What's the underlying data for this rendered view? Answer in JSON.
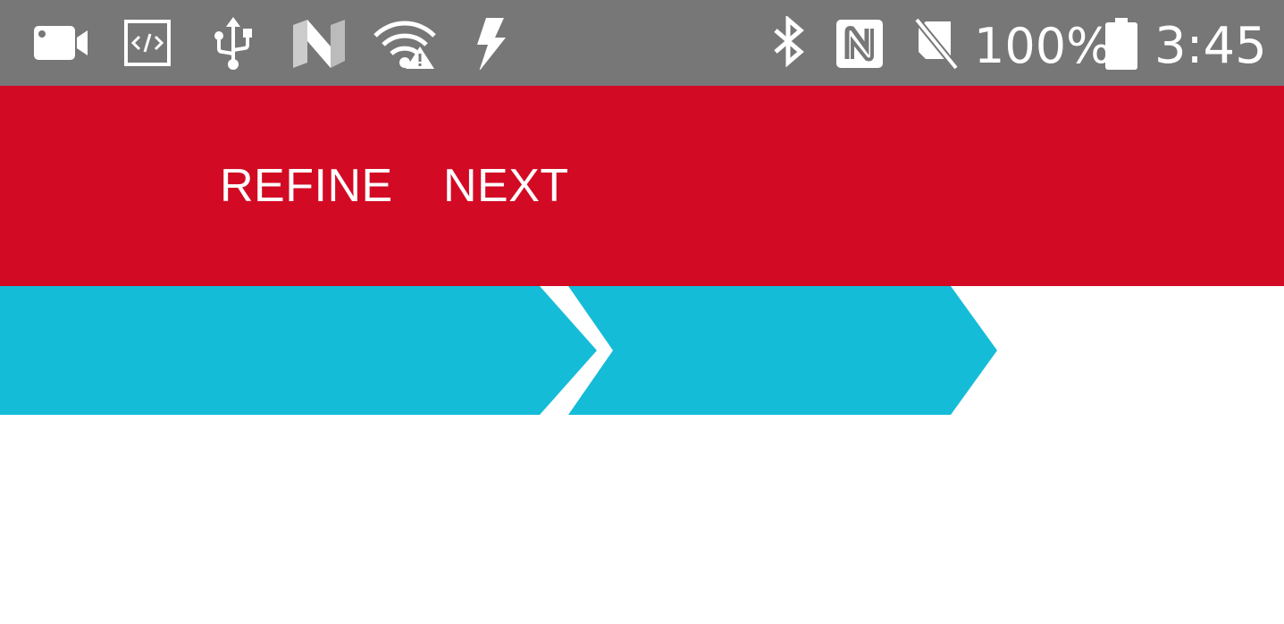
{
  "status_bar": {
    "left_icons": [
      "video-camera-icon",
      "developer-code-icon",
      "usb-icon",
      "nougat-logo-icon",
      "wifi-warning-icon",
      "flash-icon"
    ],
    "right_icons": [
      "bluetooth-icon",
      "nfc-icon",
      "no-sim-icon",
      "battery-icon"
    ],
    "battery_percent": "100%",
    "time": "3:45",
    "background_color": "#777777"
  },
  "toolbar": {
    "refine_label": "REFINE",
    "next_label": "NEXT",
    "background_color": "#d30a24"
  },
  "steps": {
    "items": [
      "step-1",
      "step-2"
    ],
    "color": "#15bcd8"
  }
}
